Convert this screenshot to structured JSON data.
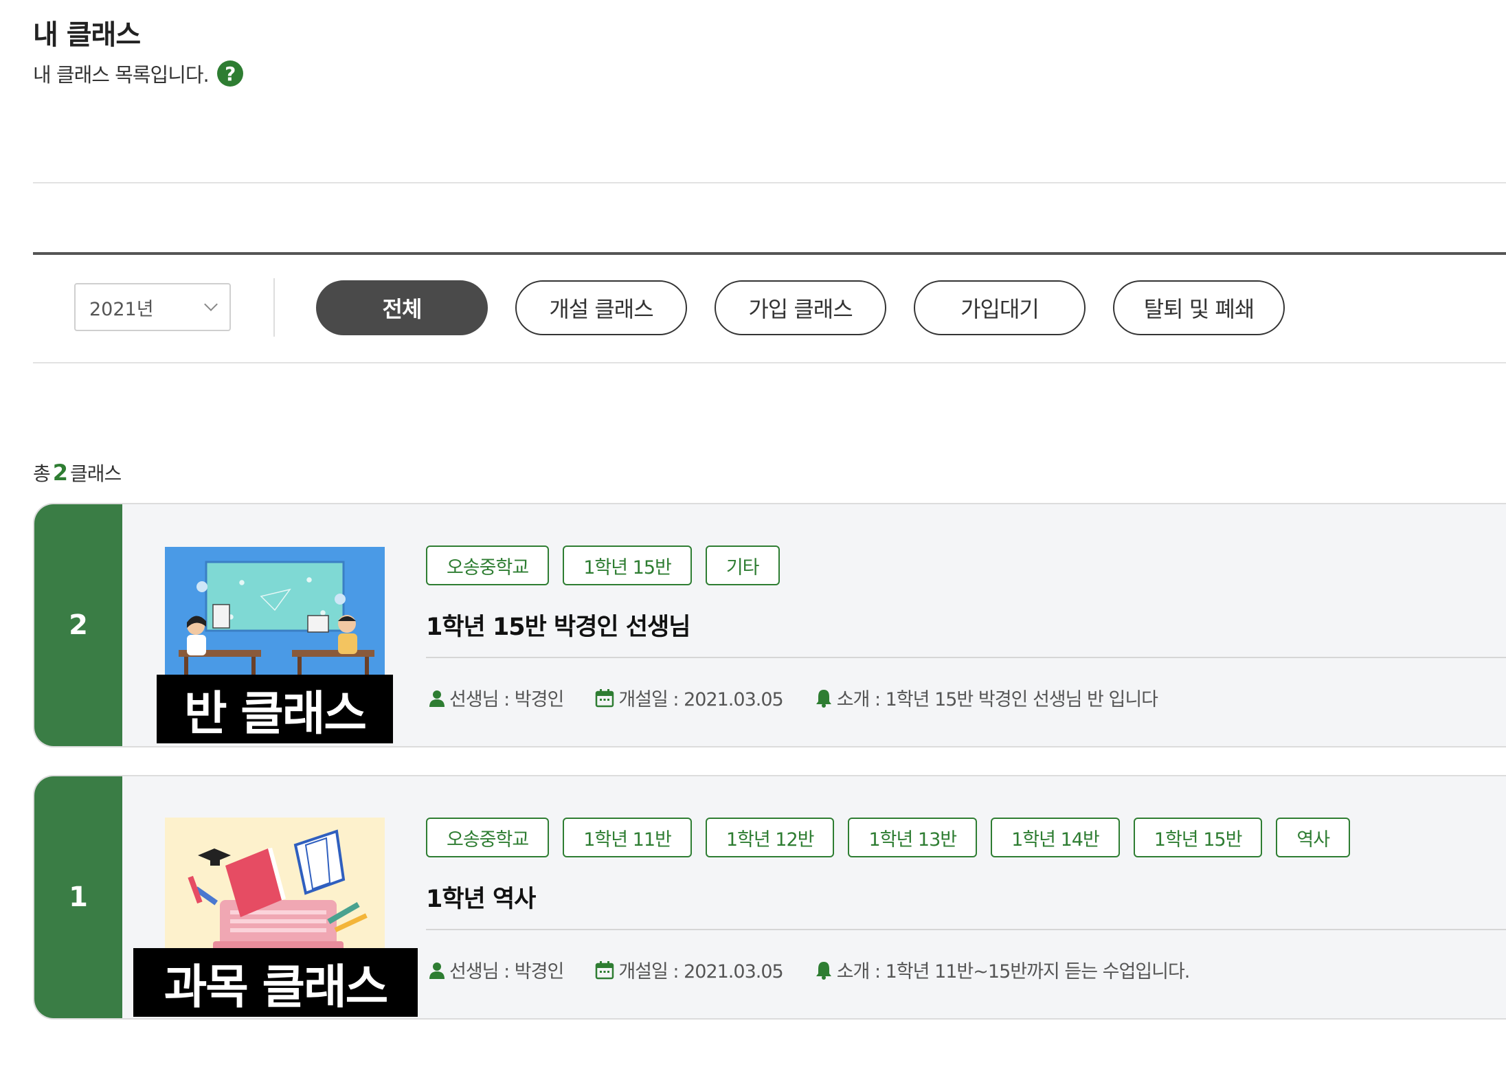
{
  "header": {
    "title": "내 클래스",
    "description": "내 클래스 목록입니다.",
    "help_icon": "?"
  },
  "filter": {
    "year_selected": "2021년",
    "tabs": [
      {
        "label": "전체",
        "active": true
      },
      {
        "label": "개설 클래스",
        "active": false
      },
      {
        "label": "가입 클래스",
        "active": false
      },
      {
        "label": "가입대기",
        "active": false
      },
      {
        "label": "탈퇴 및 폐쇄",
        "active": false
      }
    ]
  },
  "summary": {
    "prefix": "총",
    "count": "2",
    "suffix": "클래스"
  },
  "classes": [
    {
      "number": "2",
      "thumb_label": "반 클래스",
      "tags": [
        "오송중학교",
        "1학년 15반",
        "기타"
      ],
      "title": "1학년 15반 박경인 선생님",
      "teacher": "선생님 : 박경인",
      "opened": "개설일 : 2021.03.05",
      "intro": "소개 : 1학년 15반 박경인 선생님 반 입니다"
    },
    {
      "number": "1",
      "thumb_label": "과목 클래스",
      "tags": [
        "오송중학교",
        "1학년 11반",
        "1학년 12반",
        "1학년 13반",
        "1학년 14반",
        "1학년 15반",
        "역사"
      ],
      "title": "1학년 역사",
      "teacher": "선생님 : 박경인",
      "opened": "개설일 : 2021.03.05",
      "intro": "소개 : 1학년 11반~15반까지 듣는 수업입니다."
    }
  ],
  "colors": {
    "accent_green": "#2e7d32",
    "card_stripe": "#3a7d45",
    "active_pill": "#4a4a4a"
  }
}
